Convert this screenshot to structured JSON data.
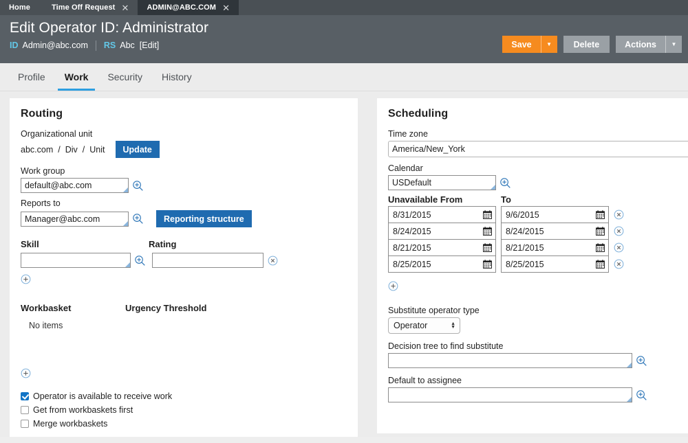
{
  "browser_tabs": [
    {
      "label": "Home",
      "closable": false,
      "active": false
    },
    {
      "label": "Time Off Request",
      "closable": true,
      "active": false
    },
    {
      "label": "ADMIN@ABC.COM",
      "closable": true,
      "active": true
    }
  ],
  "header": {
    "title": "Edit Operator ID: Administrator",
    "id_badge": "ID",
    "id_value": "Admin@abc.com",
    "rs_badge": "RS",
    "rs_value": "Abc",
    "edit_link": "[Edit]",
    "save_label": "Save",
    "delete_label": "Delete",
    "actions_label": "Actions",
    "save_color": "#f68b1f",
    "button_color": "#9aa0a5",
    "background": "#585f65",
    "badge_color": "#63c8e8"
  },
  "subtabs": [
    {
      "label": "Profile",
      "active": false
    },
    {
      "label": "Work",
      "active": true
    },
    {
      "label": "Security",
      "active": false
    },
    {
      "label": "History",
      "active": false
    }
  ],
  "accent_color": "#2d9ee0",
  "routing": {
    "title": "Routing",
    "org_unit_label": "Organizational unit",
    "org_unit_path": [
      "abc.com",
      "Div",
      "Unit"
    ],
    "org_unit_separator": "/",
    "update_label": "Update",
    "work_group_label": "Work group",
    "work_group_value": "default@abc.com",
    "reports_to_label": "Reports to",
    "reports_to_value": "Manager@abc.com",
    "reporting_structure_label": "Reporting structure",
    "skill_label": "Skill",
    "skill_value": "",
    "rating_label": "Rating",
    "rating_value": "",
    "workbasket_label": "Workbasket",
    "urgency_label": "Urgency Threshold",
    "no_items": "No items",
    "checkboxes": [
      {
        "label": "Operator is available to receive work",
        "checked": true
      },
      {
        "label": "Get from workbaskets first",
        "checked": false
      },
      {
        "label": "Merge workbaskets",
        "checked": false
      }
    ]
  },
  "scheduling": {
    "title": "Scheduling",
    "timezone_label": "Time zone",
    "timezone_value": "America/New_York",
    "calendar_label": "Calendar",
    "calendar_value": "USDefault",
    "unavailable_from_label": "Unavailable From",
    "to_label": "To",
    "unavailable_rows": [
      {
        "from": "8/31/2015",
        "to": "9/6/2015"
      },
      {
        "from": "8/24/2015",
        "to": "8/24/2015"
      },
      {
        "from": "8/21/2015",
        "to": "8/21/2015"
      },
      {
        "from": "8/25/2015",
        "to": "8/25/2015"
      }
    ],
    "substitute_type_label": "Substitute operator type",
    "substitute_type_value": "Operator",
    "decision_tree_label": "Decision tree to find substitute",
    "decision_tree_value": "",
    "default_assignee_label": "Default to assignee",
    "default_assignee_value": ""
  }
}
